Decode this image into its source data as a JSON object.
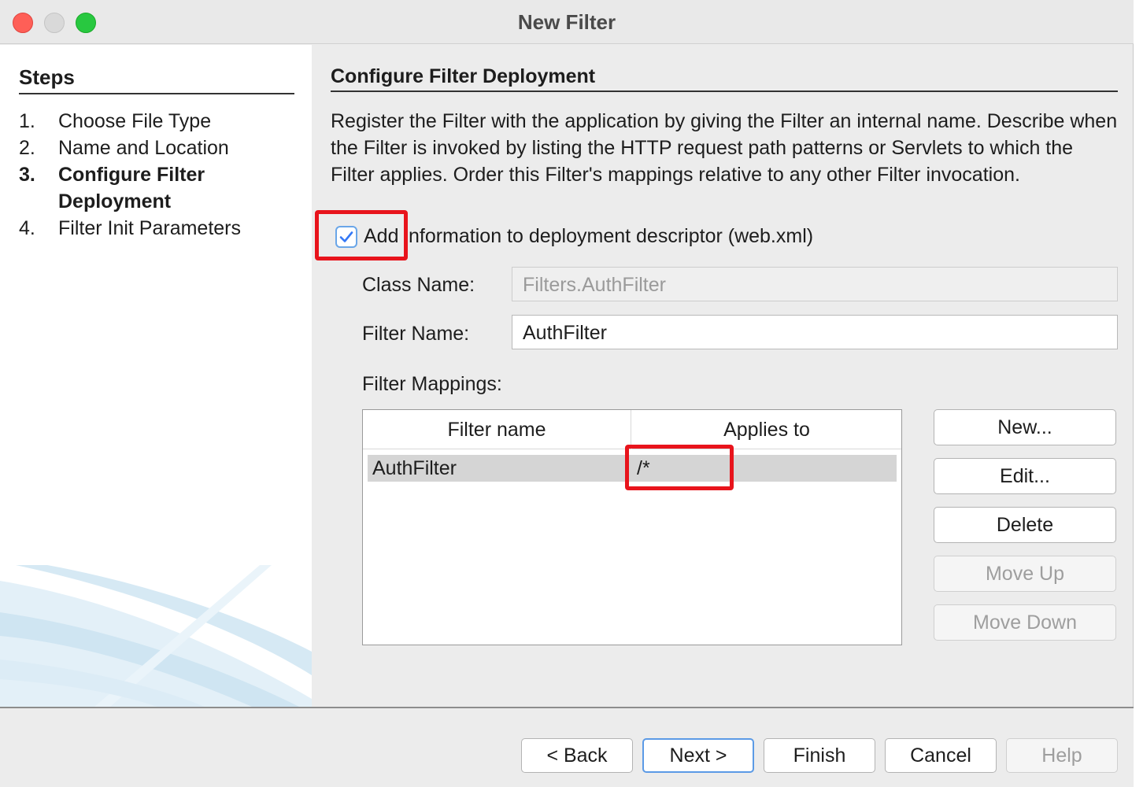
{
  "window": {
    "title": "New Filter"
  },
  "steps": {
    "heading": "Steps",
    "items": [
      {
        "num": "1.",
        "label": "Choose File Type"
      },
      {
        "num": "2.",
        "label": "Name and Location"
      },
      {
        "num": "3.",
        "label": "Configure Filter Deployment"
      },
      {
        "num": "4.",
        "label": "Filter Init Parameters"
      }
    ]
  },
  "main": {
    "section_title": "Configure Filter Deployment",
    "description": "Register the Filter with the application by giving the Filter an internal name. Describe when the Filter is invoked by listing the HTTP request path patterns or Servlets to which the Filter applies. Order this Filter's mappings relative to any other Filter invocation.",
    "add_info_checkbox": {
      "label": "Add information to deployment descriptor (web.xml)",
      "checked": true
    },
    "class_name": {
      "label": "Class Name:",
      "value": "Filters.AuthFilter"
    },
    "filter_name": {
      "label": "Filter Name:",
      "value": "AuthFilter"
    },
    "mappings": {
      "label": "Filter Mappings:",
      "columns": [
        "Filter name",
        "Applies to"
      ],
      "rows": [
        [
          "AuthFilter",
          "/*"
        ]
      ]
    },
    "side_buttons": {
      "new": "New...",
      "edit": "Edit...",
      "delete": "Delete",
      "move_up": "Move Up",
      "move_down": "Move Down"
    }
  },
  "footer": {
    "back": "< Back",
    "next": "Next >",
    "finish": "Finish",
    "cancel": "Cancel",
    "help": "Help"
  },
  "colors": {
    "highlight": "#e8141c",
    "checkbox_accent": "#6aa6e8",
    "primary_button_border": "#5b9ae6"
  }
}
